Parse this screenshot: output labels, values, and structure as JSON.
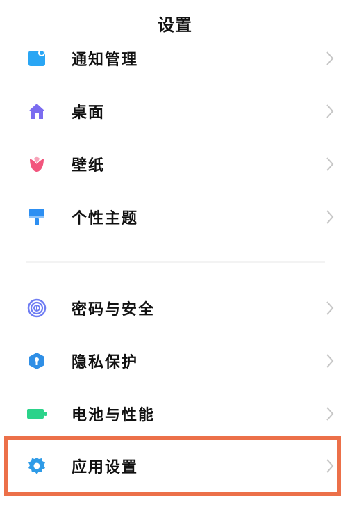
{
  "header": {
    "title": "设置"
  },
  "group1": [
    {
      "label": "通知管理",
      "icon": "notification-icon",
      "icon_color": "#2aa6f4"
    },
    {
      "label": "桌面",
      "icon": "home-icon",
      "icon_color": "#7b6cf0"
    },
    {
      "label": "壁纸",
      "icon": "tulip-wallpaper-icon",
      "icon_color": "#f2557d"
    },
    {
      "label": "个性主题",
      "icon": "paintbrush-icon",
      "icon_color": "#2d8ff2"
    }
  ],
  "group2": [
    {
      "label": "密码与安全",
      "icon": "fingerprint-icon",
      "icon_color": "#6f7df3"
    },
    {
      "label": "隐私保护",
      "icon": "privacy-shield-icon",
      "icon_color": "#2f8fe6"
    },
    {
      "label": "电池与性能",
      "icon": "battery-icon",
      "icon_color": "#2bd38a"
    },
    {
      "label": "应用设置",
      "icon": "gear-icon",
      "icon_color": "#2f9be7"
    }
  ],
  "highlight_color": "#ec7049"
}
